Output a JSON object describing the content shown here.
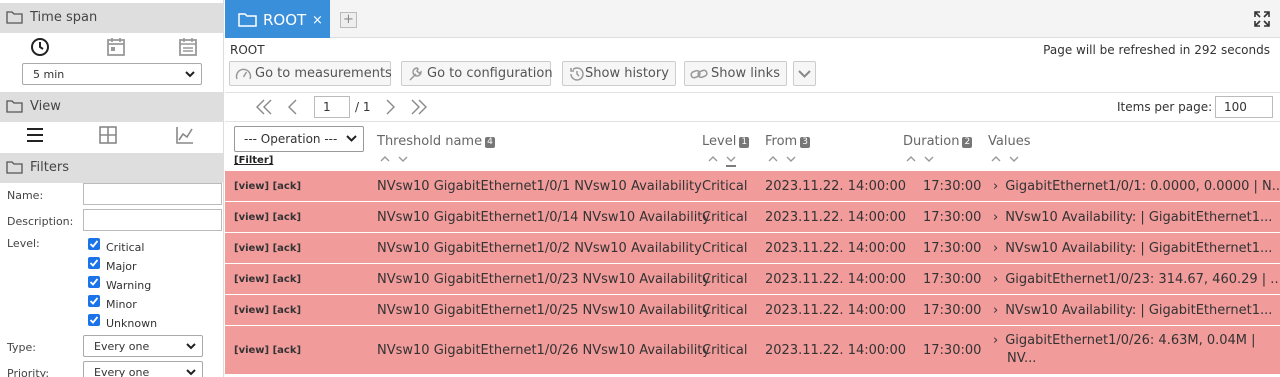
{
  "sidebar": {
    "timespan": {
      "title": "Time span",
      "selected": "5 min"
    },
    "view": {
      "title": "View"
    },
    "filters": {
      "title": "Filters",
      "name_label": "Name:",
      "description_label": "Description:",
      "level_label": "Level:",
      "levels": [
        "Critical",
        "Major",
        "Warning",
        "Minor",
        "Unknown"
      ],
      "type_label": "Type:",
      "type_value": "Every one",
      "priority_label": "Priority:",
      "priority_value": "Every one"
    }
  },
  "tab": {
    "title": "ROOT",
    "close": "×",
    "add": "+"
  },
  "breadcrumb": "ROOT",
  "refresh_text": "Page will be refreshed in 292 seconds",
  "toolbar": {
    "measurements": "Go to measurements",
    "configuration": "Go to configuration",
    "history": "Show history",
    "links": "Show links"
  },
  "pager": {
    "page": "1",
    "total": "/ 1",
    "items_label": "Items per page:",
    "items_value": "100"
  },
  "table": {
    "operation": "--- Operation ---",
    "filter": "[Filter]",
    "columns": {
      "name": "Threshold name",
      "name_badge": "4",
      "level": "Level",
      "level_badge": "1",
      "from": "From",
      "from_badge": "3",
      "duration": "Duration",
      "duration_badge": "2",
      "values": "Values"
    },
    "rows": [
      {
        "actions": "[view] [ack]",
        "name": "NVsw10 GigabitEthernet1/0/1 NVsw10 Availability",
        "level": "Critical",
        "from": "2023.11.22. 14:00:00",
        "duration": "17:30:00",
        "values": "GigabitEthernet1/0/1: 0.0000, 0.0000 | N..."
      },
      {
        "actions": "[view] [ack]",
        "name": "NVsw10 GigabitEthernet1/0/14 NVsw10 Availability",
        "level": "Critical",
        "from": "2023.11.22. 14:00:00",
        "duration": "17:30:00",
        "values": "NVsw10 Availability: | GigabitEthernet1..."
      },
      {
        "actions": "[view] [ack]",
        "name": "NVsw10 GigabitEthernet1/0/2 NVsw10 Availability",
        "level": "Critical",
        "from": "2023.11.22. 14:00:00",
        "duration": "17:30:00",
        "values": "NVsw10 Availability: | GigabitEthernet1..."
      },
      {
        "actions": "[view] [ack]",
        "name": "NVsw10 GigabitEthernet1/0/23 NVsw10 Availability",
        "level": "Critical",
        "from": "2023.11.22. 14:00:00",
        "duration": "17:30:00",
        "values": "GigabitEthernet1/0/23: 314.67, 460.29 | ..."
      },
      {
        "actions": "[view] [ack]",
        "name": "NVsw10 GigabitEthernet1/0/25 NVsw10 Availability",
        "level": "Critical",
        "from": "2023.11.22. 14:00:00",
        "duration": "17:30:00",
        "values": "NVsw10 Availability: | GigabitEthernet1..."
      },
      {
        "actions": "[view] [ack]",
        "name": "NVsw10 GigabitEthernet1/0/26 NVsw10 Availability",
        "level": "Critical",
        "from": "2023.11.22. 14:00:00",
        "duration": "17:30:00",
        "values": "GigabitEthernet1/0/26: 4.63M, 0.04M |",
        "values_line2": "NV..."
      }
    ]
  },
  "colors": {
    "accent": "#3a8fdb",
    "critical_row": "#f19b9b",
    "section_header": "#dedede"
  }
}
